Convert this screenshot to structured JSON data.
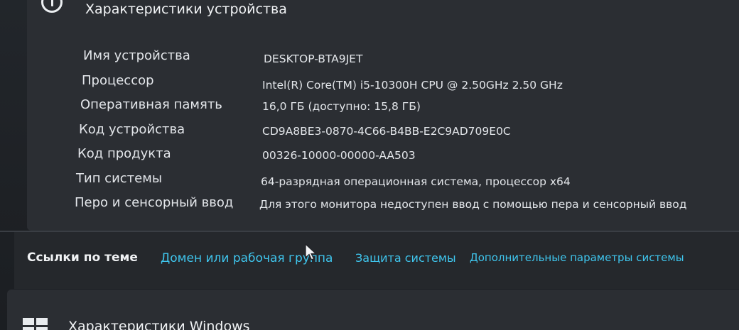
{
  "device_specs": {
    "title": "Характеристики устройства",
    "rows": [
      {
        "label": "Имя устройства",
        "value": "DESKTOP-BTA9JET"
      },
      {
        "label": "Процессор",
        "value": "Intel(R) Core(TM) i5-10300H CPU @ 2.50GHz   2.50 GHz"
      },
      {
        "label": "Оперативная память",
        "value": "16,0 ГБ (доступно: 15,8 ГБ)"
      },
      {
        "label": "Код устройства",
        "value": "CD9A8BE3-0870-4C66-B4BB-E2C9AD709E0C"
      },
      {
        "label": "Код продукта",
        "value": "00326-10000-00000-AA503"
      },
      {
        "label": "Тип системы",
        "value": "64-разрядная операционная система, процессор x64"
      },
      {
        "label": "Перо и сенсорный ввод",
        "value": "Для этого монитора недоступен ввод с помощью пера и сенсорный ввод"
      }
    ]
  },
  "related_links": {
    "title": "Ссылки по теме",
    "links": [
      {
        "label": "Домен или рабочая группа"
      },
      {
        "label": "Защита системы"
      },
      {
        "label": "Дополнительные параметры системы"
      }
    ]
  },
  "windows_specs": {
    "title": "Характеристики Windows"
  },
  "colors": {
    "link": "#3fc6ee",
    "card": "#2b2e33",
    "background": "#1e2125"
  },
  "icons": {
    "header": "info-icon",
    "windows": "windows-logo-icon",
    "cursor": "mouse-pointer-icon"
  }
}
